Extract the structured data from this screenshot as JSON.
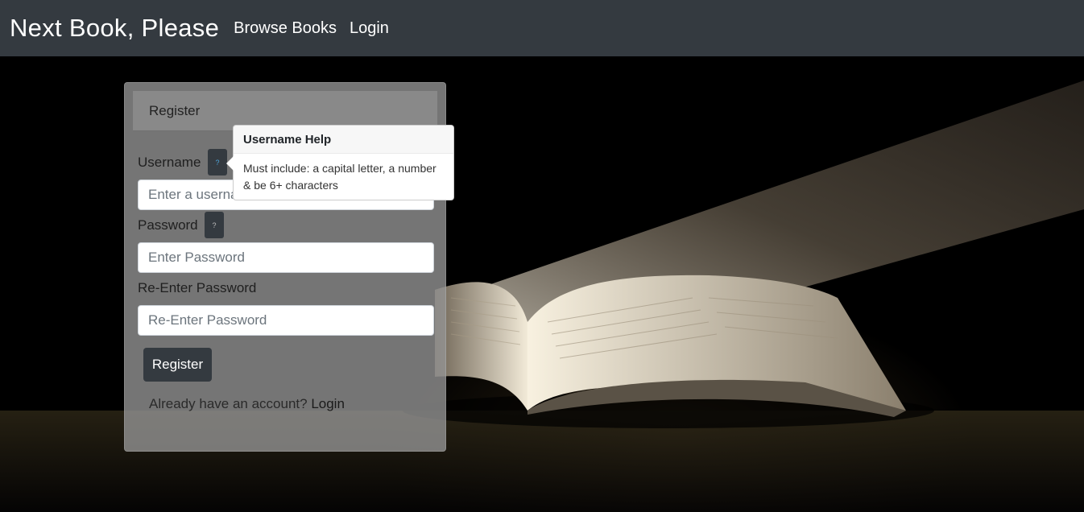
{
  "navbar": {
    "brand": "Next Book, Please",
    "links": [
      "Browse Books",
      "Login"
    ]
  },
  "register": {
    "title": "Register",
    "username_label": "Username",
    "username_placeholder": "Enter a username",
    "password_label": "Password",
    "password_placeholder": "Enter Password",
    "reenter_label": "Re-Enter Password",
    "reenter_placeholder": "Re-Enter Password",
    "help_glyph": "?",
    "submit_label": "Register",
    "account_prompt": "Already have an account? ",
    "account_link": "Login"
  },
  "popover": {
    "title": "Username Help",
    "body": "Must include: a capital letter, a number & be 6+ characters"
  },
  "colors": {
    "navbar_bg": "#343a40",
    "button_bg": "#343a40",
    "help_icon_active": "#4ea3d8"
  }
}
